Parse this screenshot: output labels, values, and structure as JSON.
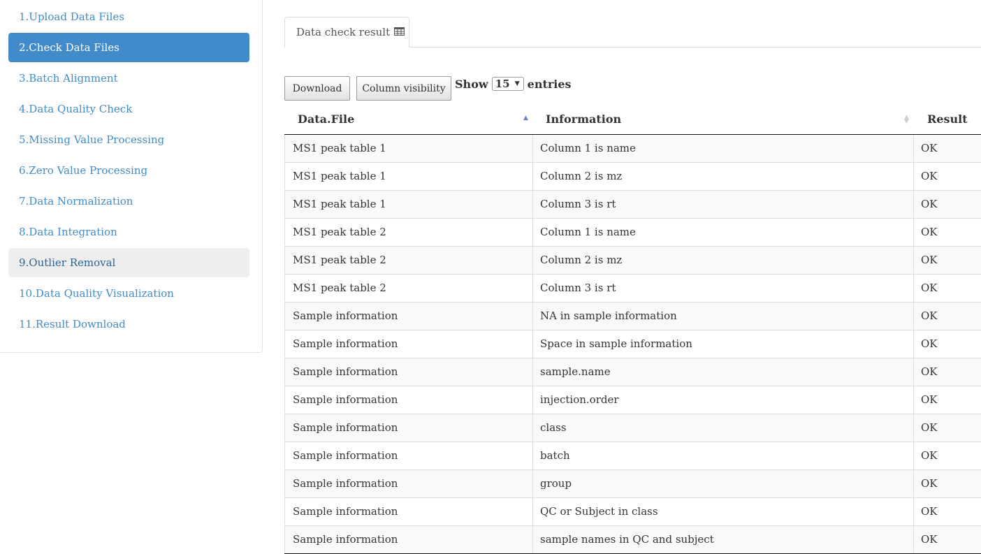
{
  "sidebar": {
    "items": [
      {
        "label": "1.Upload Data Files",
        "state": "normal"
      },
      {
        "label": "2.Check Data Files",
        "state": "active"
      },
      {
        "label": "3.Batch Alignment",
        "state": "normal"
      },
      {
        "label": "4.Data Quality Check",
        "state": "normal"
      },
      {
        "label": "5.Missing Value Processing",
        "state": "normal"
      },
      {
        "label": "6.Zero Value Processing",
        "state": "normal"
      },
      {
        "label": "7.Data Normalization",
        "state": "normal"
      },
      {
        "label": "8.Data Integration",
        "state": "normal"
      },
      {
        "label": "9.Outlier Removal",
        "state": "hover"
      },
      {
        "label": "10.Data Quality Visualization",
        "state": "normal"
      },
      {
        "label": "11.Result Download",
        "state": "normal"
      }
    ]
  },
  "tab": {
    "label": "Data check result",
    "icon": "table-icon"
  },
  "controls": {
    "download_label": "Download",
    "column_visibility_label": "Column visibility",
    "show_label": "Show",
    "entries_value": "15",
    "entries_label": "entries"
  },
  "table": {
    "columns": [
      "Data.File",
      "Information",
      "Result"
    ],
    "sort": {
      "column": "Data.File",
      "direction": "asc"
    },
    "rows": [
      [
        "MS1 peak table 1",
        "Column 1 is name",
        "OK"
      ],
      [
        "MS1 peak table 1",
        "Column 2 is mz",
        "OK"
      ],
      [
        "MS1 peak table 1",
        "Column 3 is rt",
        "OK"
      ],
      [
        "MS1 peak table 2",
        "Column 1 is name",
        "OK"
      ],
      [
        "MS1 peak table 2",
        "Column 2 is mz",
        "OK"
      ],
      [
        "MS1 peak table 2",
        "Column 3 is rt",
        "OK"
      ],
      [
        "Sample information",
        "NA in sample information",
        "OK"
      ],
      [
        "Sample information",
        "Space in sample information",
        "OK"
      ],
      [
        "Sample information",
        "sample.name",
        "OK"
      ],
      [
        "Sample information",
        "injection.order",
        "OK"
      ],
      [
        "Sample information",
        "class",
        "OK"
      ],
      [
        "Sample information",
        "batch",
        "OK"
      ],
      [
        "Sample information",
        "group",
        "OK"
      ],
      [
        "Sample information",
        "QC or Subject in class",
        "OK"
      ],
      [
        "Sample information",
        "sample names in QC and subject",
        "OK"
      ]
    ]
  },
  "colors": {
    "accent": "#428bca",
    "hover_bg": "#eeeeee",
    "stripe": "#f9f9f9"
  }
}
